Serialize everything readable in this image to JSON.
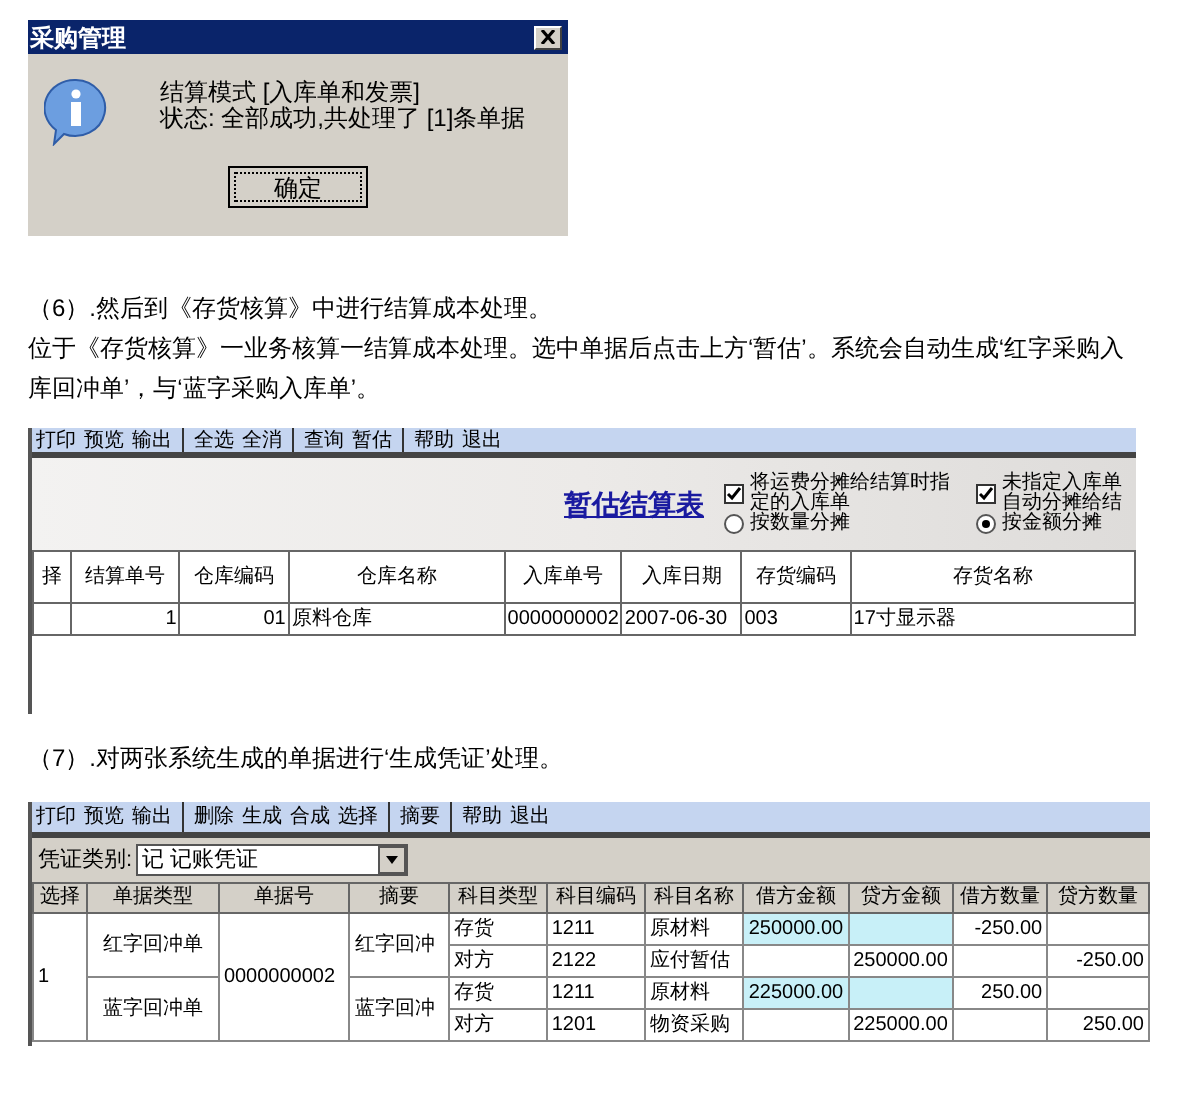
{
  "dialog": {
    "title": "采购管理",
    "lines": [
      "结算模式 [入库单和发票]",
      "状态: 全部成功,共处理了 [1]条单据"
    ],
    "button": "确定"
  },
  "paragraphs_a": [
    "（6）.然后到《存货核算》中进行结算成本处理。",
    "位于《存货核算》一业务核算一结算成本处理。选中单据后点击上方‘暂估’。系统会自动生成‘红字采购入库回冲单’，与‘蓝字采购入库单’。"
  ],
  "settle_window": {
    "toolbar": [
      [
        "打印",
        "预览",
        "输出"
      ],
      [
        "全选",
        "全消"
      ],
      [
        "查询",
        "暂估"
      ],
      [
        "帮助",
        "退出"
      ]
    ],
    "title": "暂估结算表",
    "options": [
      {
        "kind": "checkbox",
        "label": "将运费分摊给结算时指定的入库单",
        "checked": true
      },
      {
        "kind": "checkbox",
        "label": "未指定入库单自动分摊给结",
        "checked": true
      },
      {
        "kind": "radio",
        "label": "按数量分摊",
        "selected": false
      },
      {
        "kind": "radio",
        "label": "按金额分摊",
        "selected": true
      }
    ],
    "columns": [
      "择",
      "结算单号",
      "仓库编码",
      "仓库名称",
      "入库单号",
      "入库日期",
      "存货编码",
      "存货名称"
    ],
    "rows": [
      [
        null,
        "1",
        "01",
        "原料仓库",
        "0000000002",
        "2007-06-30",
        "003",
        "17寸显示器"
      ]
    ]
  },
  "paragraphs_b": [
    "（7）.对两张系统生成的单据进行‘生成凭证’处理。"
  ],
  "voucher_window": {
    "toolbar": [
      [
        "打印",
        "预览",
        "输出"
      ],
      [
        "删除",
        "生成",
        "合成",
        "选择"
      ],
      [
        "摘要"
      ],
      [
        "帮助",
        "退出"
      ]
    ],
    "voucher_type_label": "凭证类别:",
    "voucher_type": "记 记账凭证",
    "columns": [
      "选择",
      "单据类型",
      "单据号",
      "摘要",
      "科目类型",
      "科目编码",
      "科目名称",
      "借方金额",
      "贷方金额",
      "借方数量",
      "贷方数量"
    ],
    "select": "1",
    "doc_no": "0000000002",
    "groups": [
      {
        "doc_type": "红字回冲单",
        "summary": "红字回冲",
        "lines": [
          {
            "subject_type": "存货",
            "code": "1211",
            "name": "原材料",
            "debit": "250000.00",
            "debit_qty": "-250.00",
            "highlighted": true
          },
          {
            "subject_type": "对方",
            "code": "2122",
            "name": "应付暂估",
            "credit": "250000.00",
            "credit_qty": "-250.00",
            "highlighted": false
          }
        ]
      },
      {
        "doc_type": "蓝字回冲单",
        "summary": "蓝字回冲",
        "lines": [
          {
            "subject_type": "存货",
            "code": "1211",
            "name": "原材料",
            "debit": "225000.00",
            "debit_qty": "250.00",
            "highlighted": true
          },
          {
            "subject_type": "对方",
            "code": "1201",
            "name": "物资采购",
            "credit": "225000.00",
            "credit_qty": "250.00",
            "highlighted": false
          }
        ]
      }
    ]
  }
}
